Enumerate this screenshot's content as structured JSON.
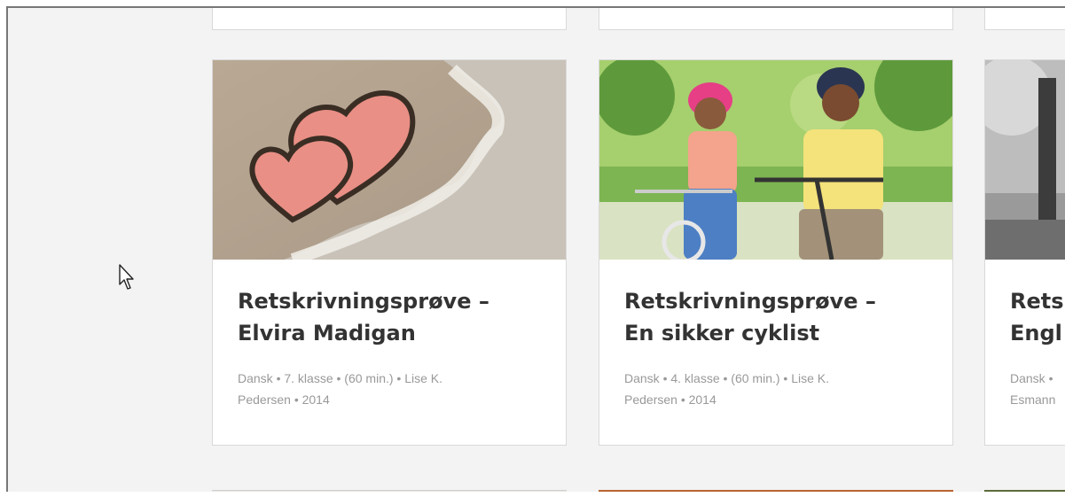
{
  "cards": [
    {
      "title_line1": "Retskrivningsprøve –",
      "title_line2": "Elvira Madigan",
      "meta_line1": "Dansk • 7. klasse • (60 min.) • Lise K.",
      "meta_line2": "Pedersen • 2014",
      "image": "sand-hearts-beach-photo"
    },
    {
      "title_line1": "Retskrivningsprøve –",
      "title_line2": "En sikker cyklist",
      "meta_line1": "Dansk • 4. klasse • (60 min.) • Lise K.",
      "meta_line2": "Pedersen • 2014",
      "image": "kids-on-bikes-photo"
    },
    {
      "title_line1": "Rets",
      "title_line2": "Engl",
      "meta_line1": "Dansk •",
      "meta_line2": "Esmann",
      "image": "black-white-trees-photo"
    }
  ],
  "cursor_icon": "mouse-pointer-icon",
  "colors": {
    "background": "#f3f3f3",
    "card": "#ffffff",
    "title": "#333333",
    "meta": "#999999"
  }
}
